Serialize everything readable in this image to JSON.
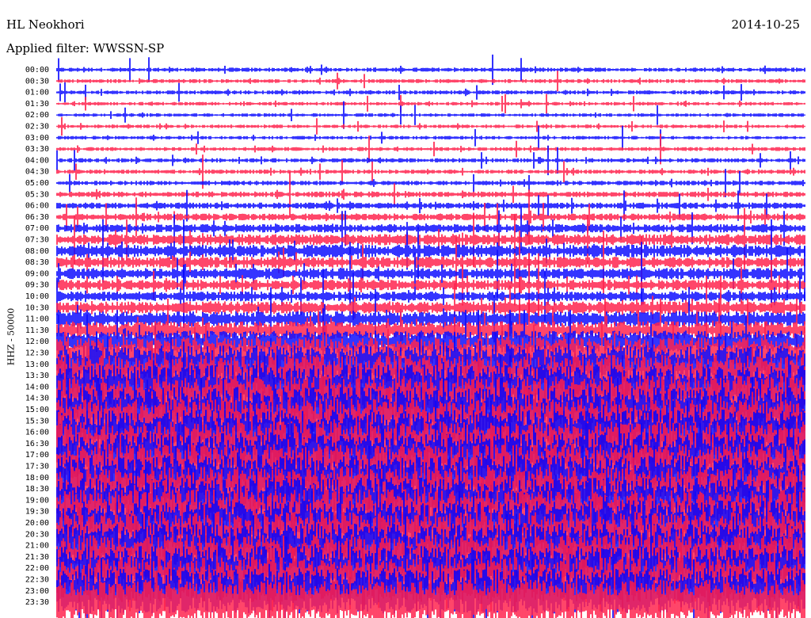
{
  "header": {
    "station": "HL Neokhori",
    "date": "2014-10-25",
    "filter_label": "Applied filter: WWSSN-SP"
  },
  "y_axis_label": "HHZ - 50000",
  "colors": {
    "trace_a": "#0000ff",
    "trace_b": "#ff1744",
    "background": "#ffffff"
  },
  "chart_data": {
    "type": "line",
    "title": "HL Neokhori",
    "subtitle": "Applied filter: WWSSN-SP",
    "ylabel": "HHZ - 50000",
    "row_labels": [
      "00:00",
      "00:30",
      "01:00",
      "01:30",
      "02:00",
      "02:30",
      "03:00",
      "03:30",
      "04:00",
      "04:30",
      "05:00",
      "05:30",
      "06:00",
      "06:30",
      "07:00",
      "07:30",
      "08:00",
      "08:30",
      "09:00",
      "09:30",
      "10:00",
      "10:30",
      "11:00",
      "11:30",
      "12:00",
      "12:30",
      "13:00",
      "13:30",
      "14:00",
      "14:30",
      "15:00",
      "15:30",
      "16:00",
      "16:30",
      "17:00",
      "17:30",
      "18:00",
      "18:30",
      "19:00",
      "19:30",
      "20:00",
      "20:30",
      "21:00",
      "21:30",
      "22:00",
      "22:30",
      "23:00",
      "23:30"
    ],
    "row_colors": [
      "blue",
      "red"
    ],
    "row_noise_level": [
      0.6,
      0.55,
      0.55,
      0.5,
      0.5,
      0.5,
      0.5,
      0.55,
      0.6,
      0.6,
      0.65,
      0.8,
      0.9,
      1.0,
      1.2,
      1.6,
      1.8,
      1.6,
      1.6,
      1.5,
      1.4,
      1.8,
      2.2,
      2.6,
      3.2,
      4.5,
      5.5,
      6.0,
      6.5,
      6.5,
      6.5,
      6.5,
      6.5,
      6.5,
      6.5,
      6.5,
      6.5,
      6.5,
      6.5,
      6.5,
      6.5,
      6.5,
      6.5,
      6.5,
      6.5,
      6.5,
      6.5,
      6.5
    ]
  }
}
